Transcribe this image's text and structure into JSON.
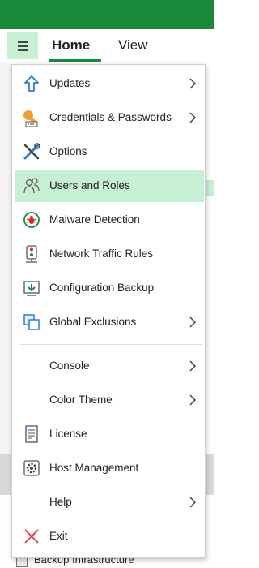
{
  "ribbon": {
    "menu_button": "hamburger-icon",
    "tabs": [
      {
        "label": "Home",
        "selected": true
      },
      {
        "label": "View",
        "selected": false
      }
    ]
  },
  "background": {
    "bottom_item": "Backup Infrastructure"
  },
  "menu": {
    "items": [
      {
        "label": "Updates",
        "icon": "updates-icon",
        "submenu": true
      },
      {
        "label": "Credentials & Passwords",
        "icon": "key-icon",
        "submenu": true
      },
      {
        "label": "Options",
        "icon": "tools-icon",
        "submenu": false
      },
      {
        "label": "Users and Roles",
        "icon": "users-icon",
        "submenu": false,
        "highlighted": true
      },
      {
        "label": "Malware Detection",
        "icon": "malware-icon",
        "submenu": false
      },
      {
        "label": "Network Traffic Rules",
        "icon": "traffic-light-icon",
        "submenu": false
      },
      {
        "label": "Configuration Backup",
        "icon": "config-backup-icon",
        "submenu": false
      },
      {
        "label": "Global Exclusions",
        "icon": "exclusions-icon",
        "submenu": true
      },
      {
        "label": "Console",
        "icon": "",
        "submenu": true
      },
      {
        "label": "Color Theme",
        "icon": "",
        "submenu": true
      },
      {
        "label": "License",
        "icon": "license-icon",
        "submenu": false
      },
      {
        "label": "Host Management",
        "icon": "gear-icon",
        "submenu": false
      },
      {
        "label": "Help",
        "icon": "",
        "submenu": true
      },
      {
        "label": "Exit",
        "icon": "close-icon",
        "submenu": false
      }
    ]
  },
  "colors": {
    "brand_green": "#1a8a3a",
    "highlight": "#c7efd4",
    "icon_blue": "#2a7fd4",
    "exit_red": "#e03a3a"
  }
}
